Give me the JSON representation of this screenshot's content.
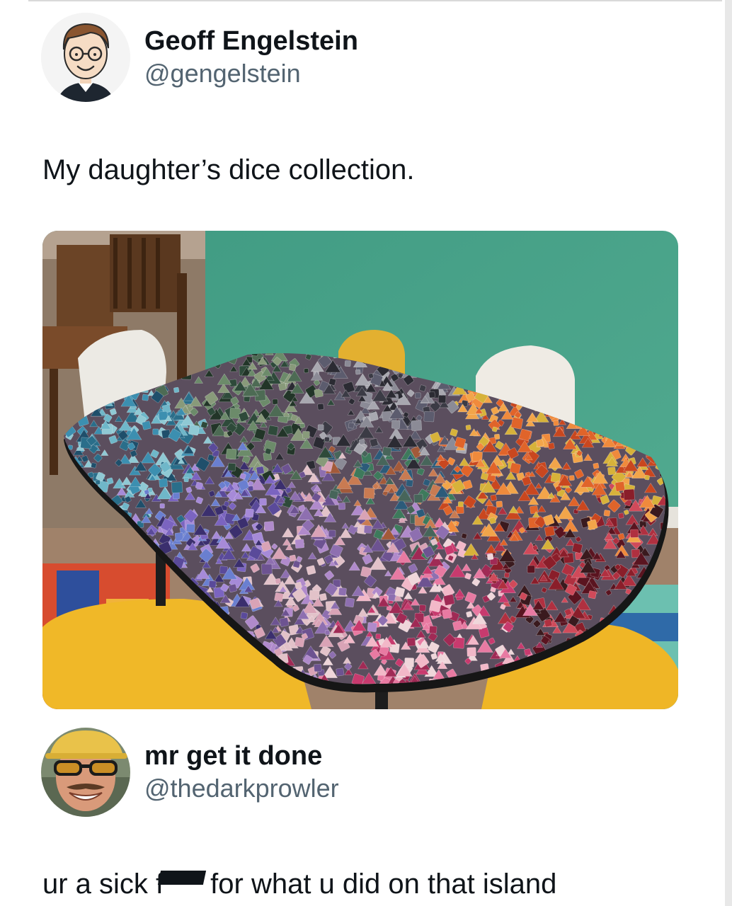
{
  "tweet": {
    "author": {
      "display_name": "Geoff Engelstein",
      "handle": "@gengelstein",
      "avatar_icon": "cartoon-man-avatar"
    },
    "text": "My daughter’s dice collection.",
    "media": {
      "icon": "photo-dice-table"
    }
  },
  "reply": {
    "author": {
      "display_name": "mr get it done",
      "handle": "@thedarkprowler",
      "avatar_icon": "man-sunglasses-hardhat-avatar"
    },
    "text_before": "ur a sick f",
    "text_after": "for what u did on that island"
  },
  "colors": {
    "text_primary": "#0f1419",
    "text_secondary": "#536471",
    "wall": "#4fa78d"
  }
}
